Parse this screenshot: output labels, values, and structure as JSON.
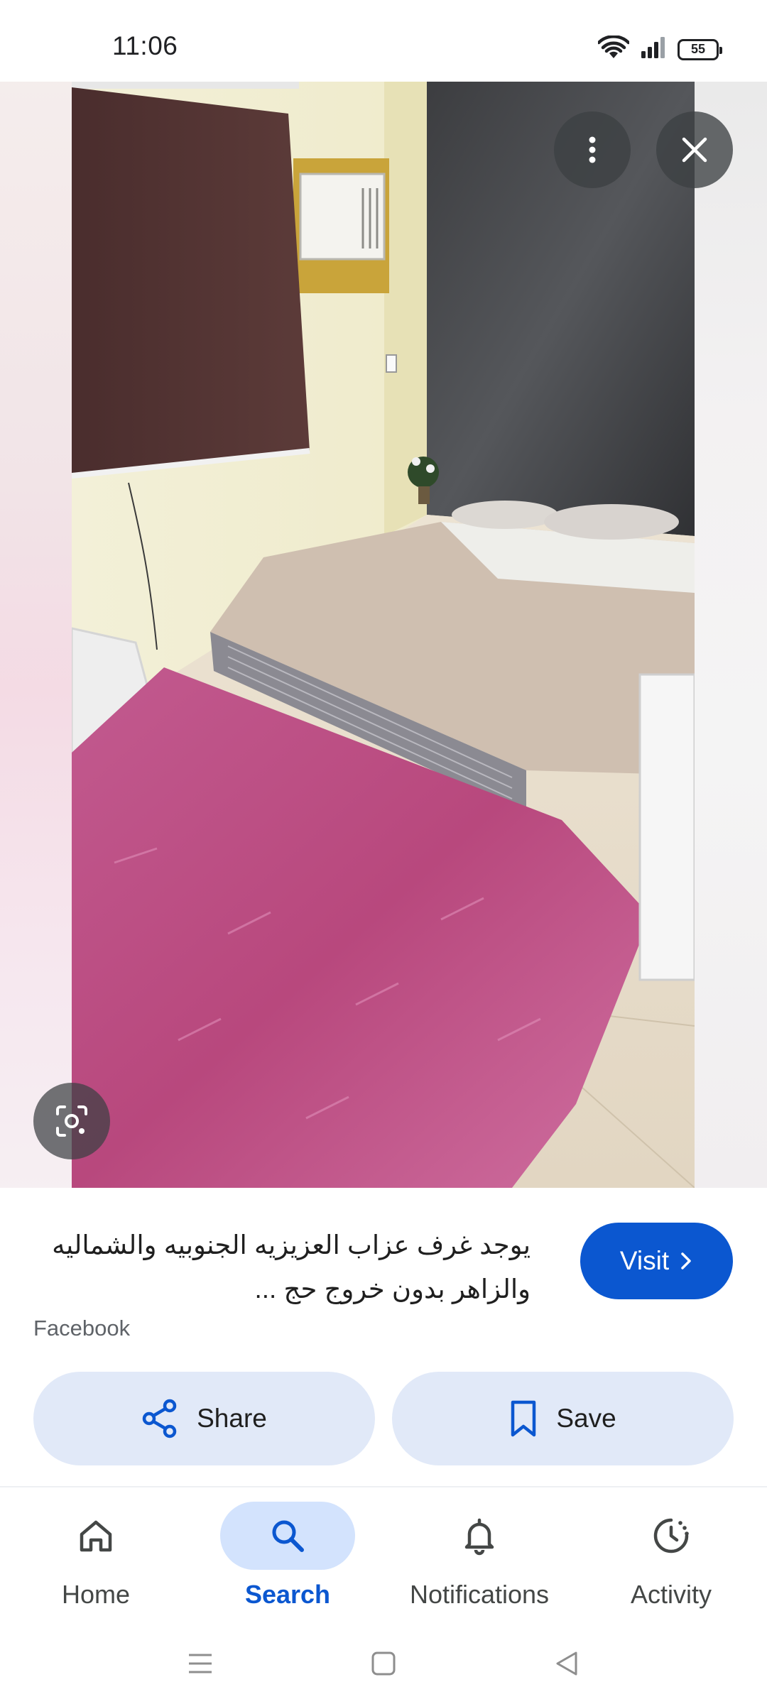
{
  "status_bar": {
    "time": "11:06",
    "battery": "55",
    "icons": [
      "wifi-icon",
      "signal-icon",
      "battery-icon"
    ]
  },
  "viewer": {
    "subject": "bedroom-photo",
    "more_icon": "more-vert-icon",
    "close_icon": "close-icon",
    "lens_icon": "lens-icon"
  },
  "result": {
    "title_line1": "يوجد غرف عزاب العزيزيه الجنوبيه والشماليه",
    "title_line2": "والزاهر بدون خروج حج ...",
    "source": "Facebook",
    "visit_label": "Visit",
    "share_label": "Share",
    "save_label": "Save"
  },
  "bottom_nav": {
    "items": [
      {
        "label": "Home",
        "icon": "home-icon"
      },
      {
        "label": "Search",
        "icon": "search-icon",
        "active": true
      },
      {
        "label": "Notifications",
        "icon": "bell-icon"
      },
      {
        "label": "Activity",
        "icon": "activity-icon"
      }
    ]
  },
  "colors": {
    "accent": "#0b57d0",
    "action_bg": "#e1e9f8",
    "active_pill": "#d3e3fd"
  }
}
